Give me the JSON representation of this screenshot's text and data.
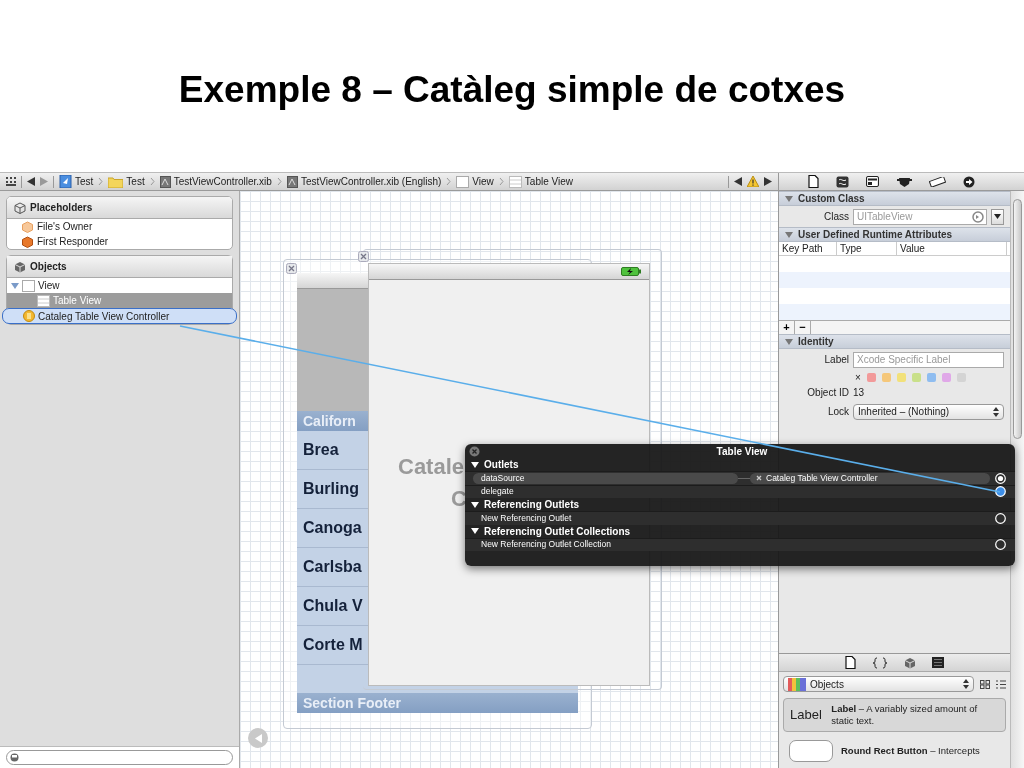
{
  "slide_title": "Exemple 8 – Catàleg simple de cotxes",
  "jump_bar": {
    "crumbs": [
      {
        "label": "Test",
        "kind": "project"
      },
      {
        "label": "Test",
        "kind": "folder"
      },
      {
        "label": "TestViewController.xib",
        "kind": "xib"
      },
      {
        "label": "TestViewController.xib (English)",
        "kind": "xib"
      },
      {
        "label": "View",
        "kind": "view"
      },
      {
        "label": "Table View",
        "kind": "table"
      }
    ]
  },
  "outline": {
    "placeholders": {
      "title": "Placeholders",
      "items": [
        {
          "label": "File's Owner",
          "kind": "owner"
        },
        {
          "label": "First Responder",
          "kind": "responder"
        }
      ]
    },
    "objects": {
      "title": "Objects",
      "items": [
        {
          "label": "View",
          "kind": "view",
          "expanded": true,
          "selected": false,
          "drop_target": false,
          "children": [
            {
              "label": "Table View",
              "kind": "table",
              "selected": true,
              "drop_target": false
            }
          ]
        },
        {
          "label": "Cataleg Table View Controller",
          "kind": "controller",
          "selected": false,
          "drop_target": true
        }
      ]
    }
  },
  "canvas": {
    "back_view": {
      "section_header": "Californ",
      "rows": [
        "Brea",
        "Burling",
        "Canoga",
        "Carlsba",
        "Chula V",
        "Corte M"
      ],
      "section_footer": "Section Footer"
    },
    "front_view": {
      "title_lines": [
        "Catale",
        "C"
      ]
    }
  },
  "connections_popup": {
    "title": "Table View",
    "sections": [
      {
        "title": "Outlets",
        "expanded": true,
        "rows": [
          {
            "name": "dataSource",
            "target": "Cataleg Table View Controller",
            "kind": "connected"
          },
          {
            "name": "delegate",
            "kind": "dragging"
          }
        ]
      },
      {
        "title": "Referencing Outlets",
        "expanded": true,
        "rows": [
          {
            "name": "New Referencing Outlet",
            "kind": "empty"
          }
        ]
      },
      {
        "title": "Referencing Outlet Collections",
        "expanded": true,
        "rows": [
          {
            "name": "New Referencing Outlet Collection",
            "kind": "empty"
          }
        ]
      }
    ]
  },
  "inspector": {
    "custom_class": {
      "title": "Custom Class",
      "class_label": "Class",
      "class_placeholder": "UITableView"
    },
    "runtime_attributes": {
      "title": "User Defined Runtime Attributes",
      "columns": [
        "Key Path",
        "Type",
        "Value"
      ],
      "add": "+",
      "remove": "−"
    },
    "identity": {
      "title": "Identity",
      "label_label": "Label",
      "label_placeholder": "Xcode Specific Label",
      "clear_mark": "×",
      "label_colors": [
        {
          "color": "#f29a9a"
        },
        {
          "color": "#f5c77a"
        },
        {
          "color": "#f2e17a"
        },
        {
          "color": "#c9e08a"
        },
        {
          "color": "#8fbdf0"
        },
        {
          "color": "#e0a8e8"
        },
        {
          "color": "#d4d4d4"
        }
      ],
      "object_id_label": "Object ID",
      "object_id": "13",
      "lock_label": "Lock",
      "lock_value": "Inherited – (Nothing)"
    }
  },
  "library": {
    "selector": "Objects",
    "items": [
      {
        "kind": "label",
        "preview": "Label",
        "text": "**Label** – A variably sized amount of static text.",
        "selected": true
      },
      {
        "kind": "button",
        "text": "**Round Rect Button** – Intercepts",
        "selected": false
      }
    ]
  }
}
